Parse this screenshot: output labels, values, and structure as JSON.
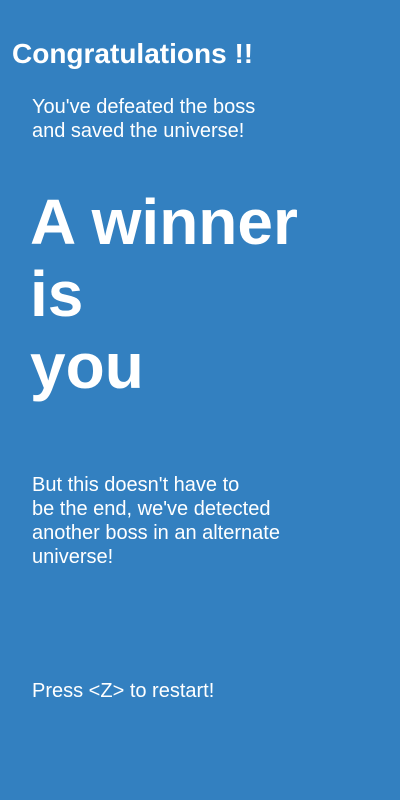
{
  "screen": {
    "background_color": "#3380c0",
    "text_color": "#ffffff",
    "title": "Congratulations !!",
    "intro_lines": [
      "You've defeated the boss",
      "and saved the universe!"
    ],
    "winner_lines": [
      "A winner",
      "is",
      "you"
    ],
    "outro_lines": [
      "But this doesn't have to",
      "be the end, we've detected",
      "another boss in an alternate",
      "universe!"
    ],
    "restart_prompt": "Press <Z> to restart!"
  }
}
